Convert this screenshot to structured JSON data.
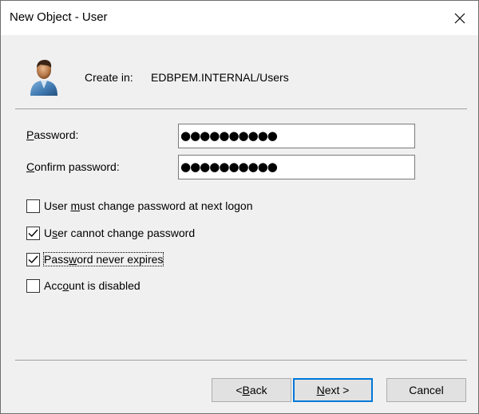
{
  "window": {
    "title": "New Object - User"
  },
  "header": {
    "create_in_label": "Create in:",
    "create_in_path": "EDBPEM.INTERNAL/Users"
  },
  "form": {
    "password": {
      "label_prefix": "",
      "label_accel": "P",
      "label_rest": "assword:",
      "value": "●●●●●●●●●●"
    },
    "confirm_password": {
      "label_prefix": "",
      "label_accel": "C",
      "label_rest": "onfirm password:",
      "value": "●●●●●●●●●●"
    }
  },
  "options": [
    {
      "label_prefix": "User ",
      "label_accel": "m",
      "label_rest": "ust change password at next logon",
      "checked": false,
      "focused": false
    },
    {
      "label_prefix": "U",
      "label_accel": "s",
      "label_rest": "er cannot change password",
      "checked": true,
      "focused": false
    },
    {
      "label_prefix": "Pass",
      "label_accel": "w",
      "label_rest": "ord never expires",
      "checked": true,
      "focused": true
    },
    {
      "label_prefix": "Acc",
      "label_accel": "o",
      "label_rest": "unt is disabled",
      "checked": false,
      "focused": false
    }
  ],
  "buttons": {
    "back": {
      "prefix": "< ",
      "accel": "B",
      "rest": "ack"
    },
    "next": {
      "prefix": "",
      "accel": "N",
      "rest": "ext >"
    },
    "cancel": {
      "label": "Cancel"
    }
  },
  "icons": {
    "close": "close-icon",
    "user": "user-icon",
    "check": "checkmark-icon"
  }
}
